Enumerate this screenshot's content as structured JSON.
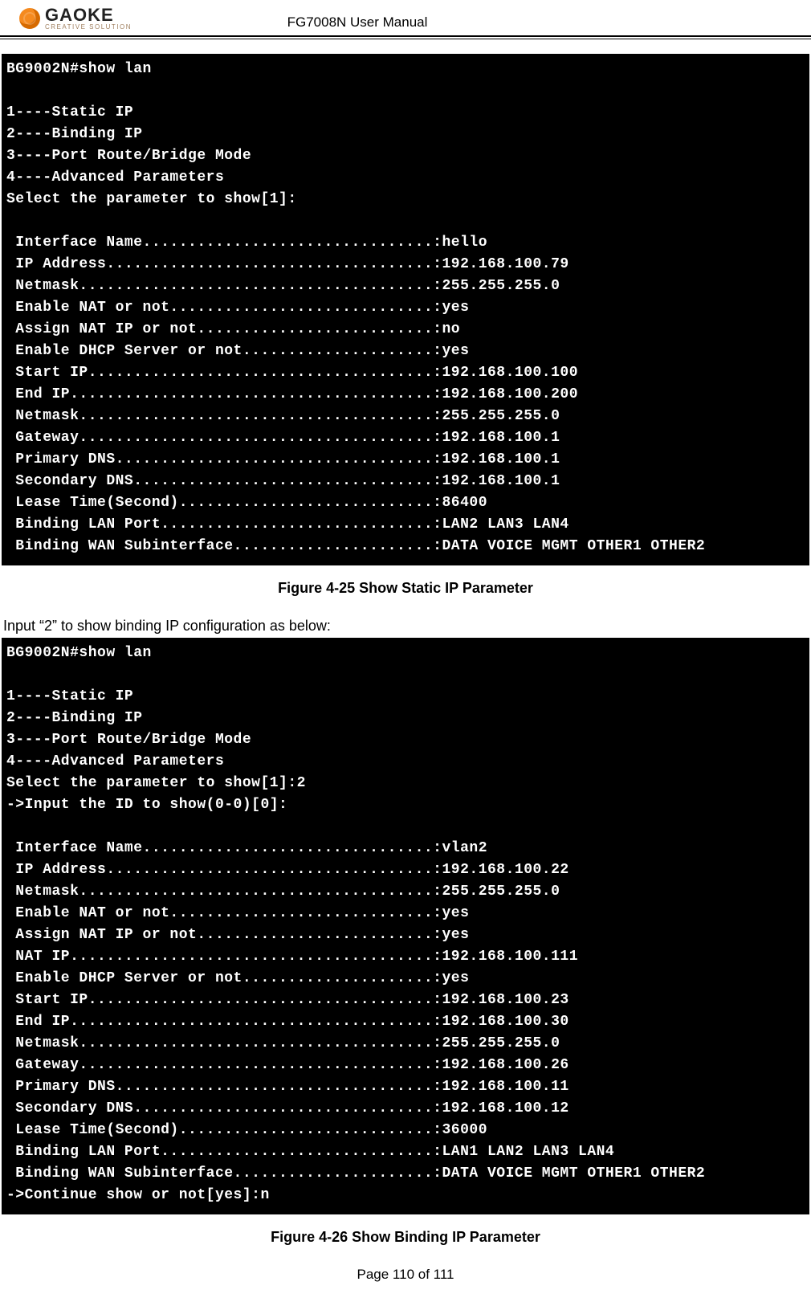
{
  "header": {
    "brand": "GAOKE",
    "tagline": "CREATIVE SOLUTION",
    "title": "FG7008N User Manual"
  },
  "terminal1": {
    "prompt": "BG9002N#show lan",
    "menu": [
      "1----Static IP",
      "2----Binding IP",
      "3----Port Route/Bridge Mode",
      "4----Advanced Parameters",
      "Select the parameter to show[1]:"
    ],
    "rows": [
      {
        "label": "Interface Name",
        "value": "hello"
      },
      {
        "label": "IP Address",
        "value": "192.168.100.79"
      },
      {
        "label": "Netmask",
        "value": "255.255.255.0"
      },
      {
        "label": "Enable NAT or not",
        "value": "yes"
      },
      {
        "label": "Assign NAT IP or not",
        "value": "no"
      },
      {
        "label": "Enable DHCP Server or not",
        "value": "yes"
      },
      {
        "label": "Start IP",
        "value": "192.168.100.100"
      },
      {
        "label": "End IP",
        "value": "192.168.100.200"
      },
      {
        "label": "Netmask",
        "value": "255.255.255.0"
      },
      {
        "label": "Gateway",
        "value": "192.168.100.1"
      },
      {
        "label": "Primary DNS",
        "value": "192.168.100.1"
      },
      {
        "label": "Secondary DNS",
        "value": "192.168.100.1"
      },
      {
        "label": "Lease Time(Second)",
        "value": "86400"
      },
      {
        "label": "Binding LAN Port",
        "value": "LAN2 LAN3 LAN4"
      },
      {
        "label": "Binding WAN Subinterface",
        "value": "DATA VOICE MGMT OTHER1 OTHER2"
      }
    ]
  },
  "caption1": "Figure 4-25  Show Static IP Parameter",
  "paragraph": "Input “2” to show binding IP configuration as below:",
  "terminal2": {
    "prompt": "BG9002N#show lan",
    "menu": [
      "1----Static IP",
      "2----Binding IP",
      "3----Port Route/Bridge Mode",
      "4----Advanced Parameters",
      "Select the parameter to show[1]:2",
      "->Input the ID to show(0-0)[0]:"
    ],
    "rows": [
      {
        "label": "Interface Name",
        "value": "vlan2"
      },
      {
        "label": "IP Address",
        "value": "192.168.100.22"
      },
      {
        "label": "Netmask",
        "value": "255.255.255.0"
      },
      {
        "label": "Enable NAT or not",
        "value": "yes"
      },
      {
        "label": "Assign NAT IP or not",
        "value": "yes"
      },
      {
        "label": "NAT IP",
        "value": "192.168.100.111"
      },
      {
        "label": "Enable DHCP Server or not",
        "value": "yes"
      },
      {
        "label": "Start IP",
        "value": "192.168.100.23"
      },
      {
        "label": "End IP",
        "value": "192.168.100.30"
      },
      {
        "label": "Netmask",
        "value": "255.255.255.0"
      },
      {
        "label": "Gateway",
        "value": "192.168.100.26"
      },
      {
        "label": "Primary DNS",
        "value": "192.168.100.11"
      },
      {
        "label": "Secondary DNS",
        "value": "192.168.100.12"
      },
      {
        "label": "Lease Time(Second)",
        "value": "36000"
      },
      {
        "label": "Binding LAN Port",
        "value": "LAN1 LAN2 LAN3 LAN4"
      },
      {
        "label": "Binding WAN Subinterface",
        "value": "DATA VOICE MGMT OTHER1 OTHER2"
      }
    ],
    "footer_line": "->Continue show or not[yes]:n"
  },
  "caption2": "Figure 4-26  Show Binding IP Parameter",
  "page_footer": "Page 110 of 111",
  "layout": {
    "dotfill_width": 46,
    "indent": " "
  }
}
